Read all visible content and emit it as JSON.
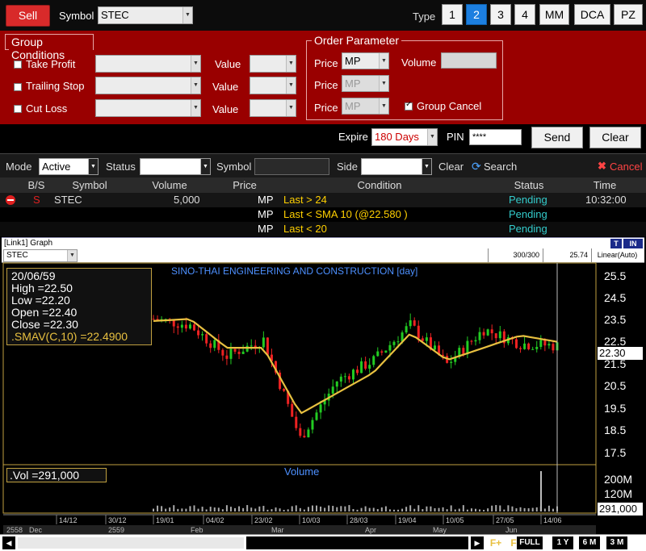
{
  "toolbar": {
    "sell_label": "Sell",
    "symbol_label": "Symbol",
    "symbol_value": "STEC",
    "type_label": "Type",
    "type_buttons": [
      "1",
      "2",
      "3",
      "4",
      "MM",
      "DCA",
      "PZ"
    ],
    "type_selected": "2"
  },
  "group_conditions": {
    "legend": "Group Conditions",
    "rows": [
      {
        "label": "Take Profit",
        "value_label": "Value"
      },
      {
        "label": "Trailing Stop",
        "value_label": "Value"
      },
      {
        "label": "Cut Loss",
        "value_label": "Value"
      }
    ]
  },
  "order_parameter": {
    "legend": "Order Parameter",
    "price_label": "Price",
    "price_values": [
      "MP",
      "MP",
      "MP"
    ],
    "volume_label": "Volume",
    "group_cancel_label": "Group Cancel",
    "group_cancel_checked": true
  },
  "submit": {
    "expire_label": "Expire",
    "expire_value": "180 Days",
    "pin_label": "PIN",
    "pin_value": "****",
    "send_label": "Send",
    "clear_label": "Clear"
  },
  "filter": {
    "mode_label": "Mode",
    "mode_value": "Active",
    "status_label": "Status",
    "symbol_label": "Symbol",
    "side_label": "Side",
    "clear_label": "Clear",
    "search_label": "Search",
    "cancel_label": "Cancel"
  },
  "orders": {
    "columns": [
      "B/S",
      "Symbol",
      "Volume",
      "Price",
      "Condition",
      "Status",
      "Time"
    ],
    "rows": [
      {
        "bs": "S",
        "symbol": "STEC",
        "volume": "5,000",
        "price": "MP",
        "condition": "Last > 24",
        "status": "Pending",
        "time": "10:32:00"
      },
      {
        "bs": "",
        "symbol": "",
        "volume": "",
        "price": "MP",
        "condition": "Last < SMA 10 (@22.580 )",
        "status": "Pending",
        "time": ""
      },
      {
        "bs": "",
        "symbol": "",
        "volume": "",
        "price": "MP",
        "condition": "Last < 20",
        "status": "Pending",
        "time": ""
      }
    ]
  },
  "graph": {
    "window_title": "[Link1] Graph",
    "badge_t": "T",
    "badge_in": "IN",
    "symbol_value": "STEC",
    "count": "300/300",
    "last_value": "25.74",
    "scale_mode": "Linear(Auto)",
    "title": "SINO-THAI ENGINEERING AND CONSTRUCTION [day]",
    "info": {
      "date": "20/06/59",
      "high": "High  =22.50",
      "low": "Low  =22.20",
      "open": "Open  =22.40",
      "close": "Close  =22.30",
      "smav": ".SMAV(C,10)   =22.4900"
    },
    "price_ticks": [
      "25.5",
      "24.5",
      "23.5",
      "22.5",
      "21.5",
      "20.5",
      "19.5",
      "18.5",
      "17.5"
    ],
    "price_marker": "22.30",
    "volume_title": "Volume",
    "volume_info": ".Vol   =291,000",
    "volume_ticks": [
      "200M",
      "120M"
    ],
    "volume_marker": "291,000",
    "date_ticks": [
      "14/12",
      "30/12",
      "19/01",
      "04/02",
      "23/02",
      "10/03",
      "28/03",
      "19/04",
      "10/05",
      "27/05",
      "14/06"
    ],
    "period_labels": [
      "2558",
      "Dec",
      "2559",
      "Feb",
      "Mar",
      "Apr",
      "May",
      "Jun"
    ],
    "range_buttons": [
      "FULL",
      "1 Y",
      "6 M",
      "3 M"
    ],
    "colors": {
      "up": "#22cc22",
      "down": "#ee2222",
      "sma": "#e8c040"
    }
  },
  "chart_data": {
    "type": "line",
    "title": "SINO-THAI ENGINEERING AND CONSTRUCTION [day]",
    "xlabel": "",
    "ylabel": "",
    "ylim": [
      17,
      26
    ],
    "x": [
      "14/12",
      "30/12",
      "19/01",
      "04/02",
      "23/02",
      "10/03",
      "28/03",
      "19/04",
      "10/05",
      "27/05",
      "14/06",
      "20/06"
    ],
    "series": [
      {
        "name": "Close",
        "values": [
          23.6,
          23.3,
          21.8,
          22.6,
          17.8,
          20.6,
          21.6,
          23.3,
          21.4,
          23.1,
          22.4,
          22.3
        ]
      },
      {
        "name": ".SMAV(C,10)",
        "values": [
          23.5,
          23.6,
          22.2,
          22.2,
          19.0,
          20.0,
          21.0,
          22.9,
          21.6,
          22.2,
          22.8,
          22.49
        ]
      }
    ]
  }
}
